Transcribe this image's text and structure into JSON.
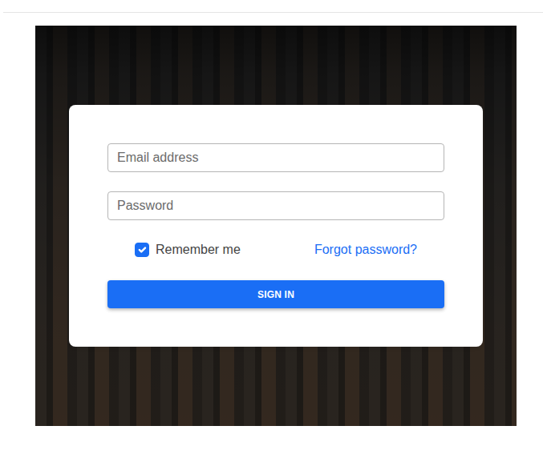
{
  "form": {
    "email": {
      "placeholder": "Email address"
    },
    "password": {
      "placeholder": "Password"
    },
    "remember": {
      "label": "Remember me",
      "checked": true
    },
    "forgot": "Forgot password?",
    "submit": "SIGN IN"
  }
}
